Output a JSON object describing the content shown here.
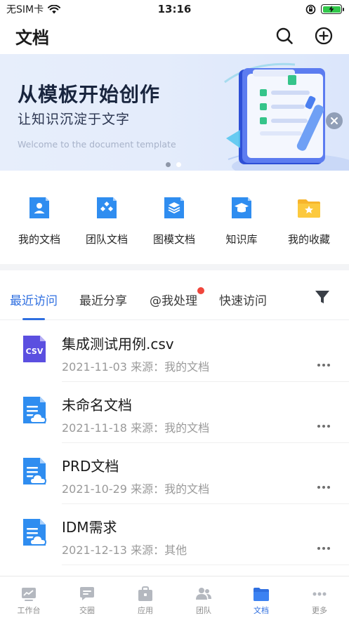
{
  "status_bar": {
    "carrier": "无SIM卡",
    "time": "13:16"
  },
  "header": {
    "title": "文档",
    "search_icon": "search-icon",
    "add_icon": "plus-circle-icon"
  },
  "banner": {
    "title": "从模板开始创作",
    "subtitle": "让知识沉淀于文字",
    "english": "Welcome to the document template",
    "slide_count": 2,
    "active_slide": 1
  },
  "quick_access": [
    {
      "label": "我的文档",
      "icon": "user-doc-icon"
    },
    {
      "label": "团队文档",
      "icon": "team-doc-icon"
    },
    {
      "label": "图模文档",
      "icon": "template-doc-icon"
    },
    {
      "label": "知识库",
      "icon": "knowledge-base-icon"
    },
    {
      "label": "我的收藏",
      "icon": "favorites-folder-icon"
    }
  ],
  "tabs": [
    {
      "label": "最近访问",
      "active": true
    },
    {
      "label": "最近分享",
      "active": false
    },
    {
      "label": "@我处理",
      "active": false,
      "badge": true
    },
    {
      "label": "快速访问",
      "active": false
    }
  ],
  "documents": [
    {
      "name": "集成测试用例.csv",
      "date": "2021-11-03",
      "source_label": "来源：",
      "source": "我的文档",
      "type": "csv"
    },
    {
      "name": "未命名文档",
      "date": "2021-11-18",
      "source_label": "来源：",
      "source": "我的文档",
      "type": "doc"
    },
    {
      "name": "PRD文档",
      "date": "2021-10-29",
      "source_label": "来源：",
      "source": "我的文档",
      "type": "doc"
    },
    {
      "name": "IDM需求",
      "date": "2021-12-13",
      "source_label": "来源：",
      "source": "其他",
      "type": "doc"
    }
  ],
  "bottom_tabs": [
    {
      "label": "工作台",
      "icon": "dashboard-icon",
      "active": false
    },
    {
      "label": "交圈",
      "icon": "chat-icon",
      "active": false
    },
    {
      "label": "应用",
      "icon": "apps-icon",
      "active": false
    },
    {
      "label": "团队",
      "icon": "team-icon",
      "active": false
    },
    {
      "label": "文档",
      "icon": "folder-icon",
      "active": true
    },
    {
      "label": "更多",
      "icon": "more-icon",
      "active": false
    }
  ],
  "colors": {
    "accent": "#2f6fe0",
    "badge": "#f0463c",
    "battery": "#31c74a"
  }
}
